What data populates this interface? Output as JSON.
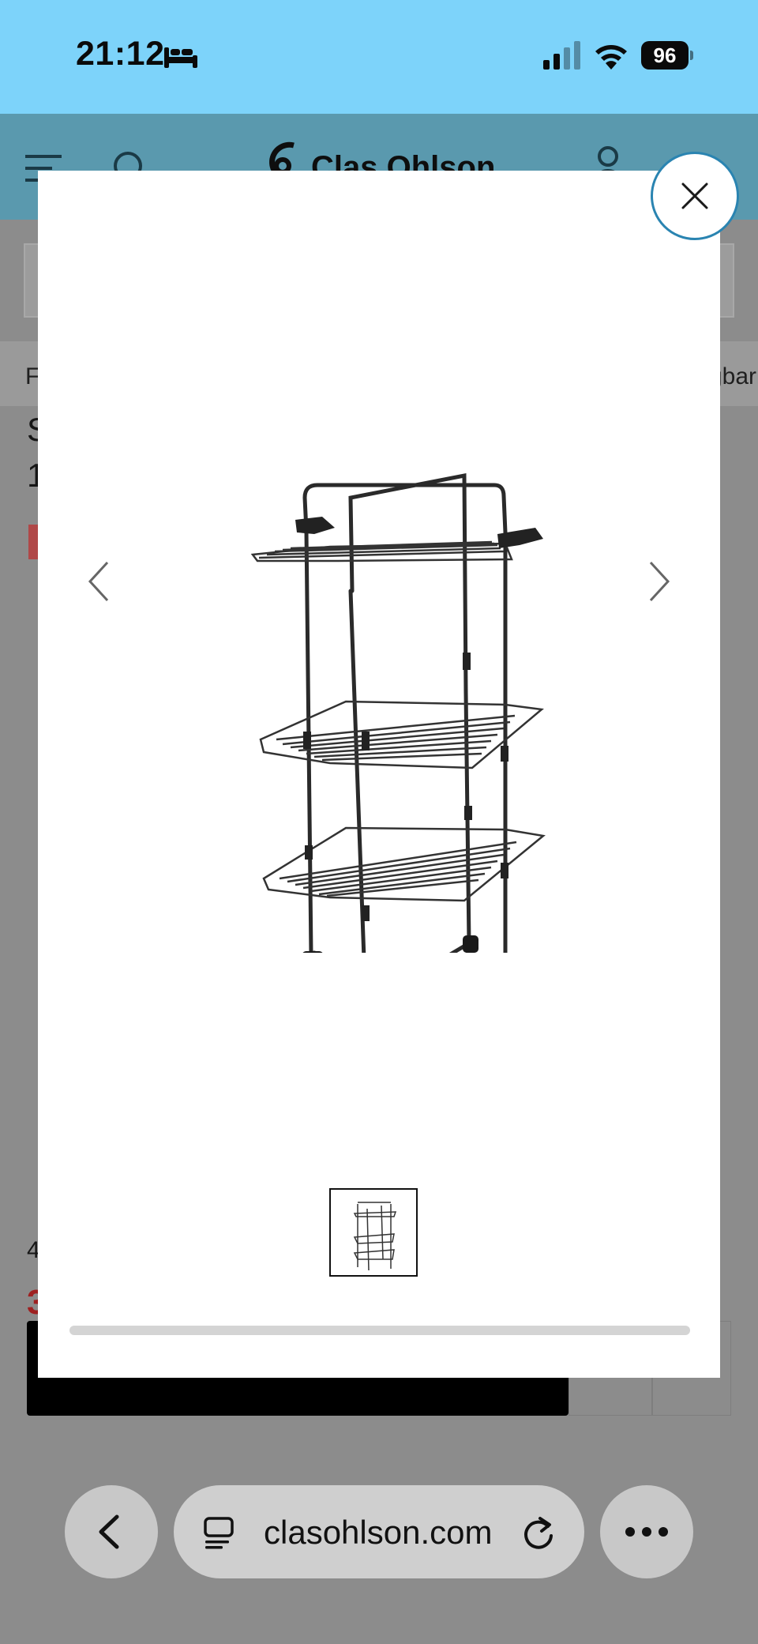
{
  "status_bar": {
    "time": "21:12",
    "battery": "96",
    "icons": [
      "bed-icon",
      "signal-icon",
      "wifi-icon",
      "battery-icon"
    ]
  },
  "site_header": {
    "logo_text": "Clas Ohlson",
    "icons": [
      "menu-icon",
      "search-icon",
      "user-icon"
    ]
  },
  "background_page": {
    "breadcrumb_first": "F",
    "breadcrumb_last": "gbar",
    "title_line_1": "S",
    "title_line_2": "1",
    "rating_text": "4",
    "price_text": "3"
  },
  "modal": {
    "image_alt": "Clothes drying rack tower with three shelves and wheels",
    "prev_icon": "chevron-left-icon",
    "next_icon": "chevron-right-icon",
    "close_icon": "close-icon",
    "thumbnail_count": 1,
    "active_thumbnail": 1,
    "accent_color": "#2a84b1"
  },
  "browser": {
    "url": "clasohlson.com",
    "icons": [
      "back-icon",
      "reader-icon",
      "reload-icon",
      "more-icon"
    ]
  }
}
